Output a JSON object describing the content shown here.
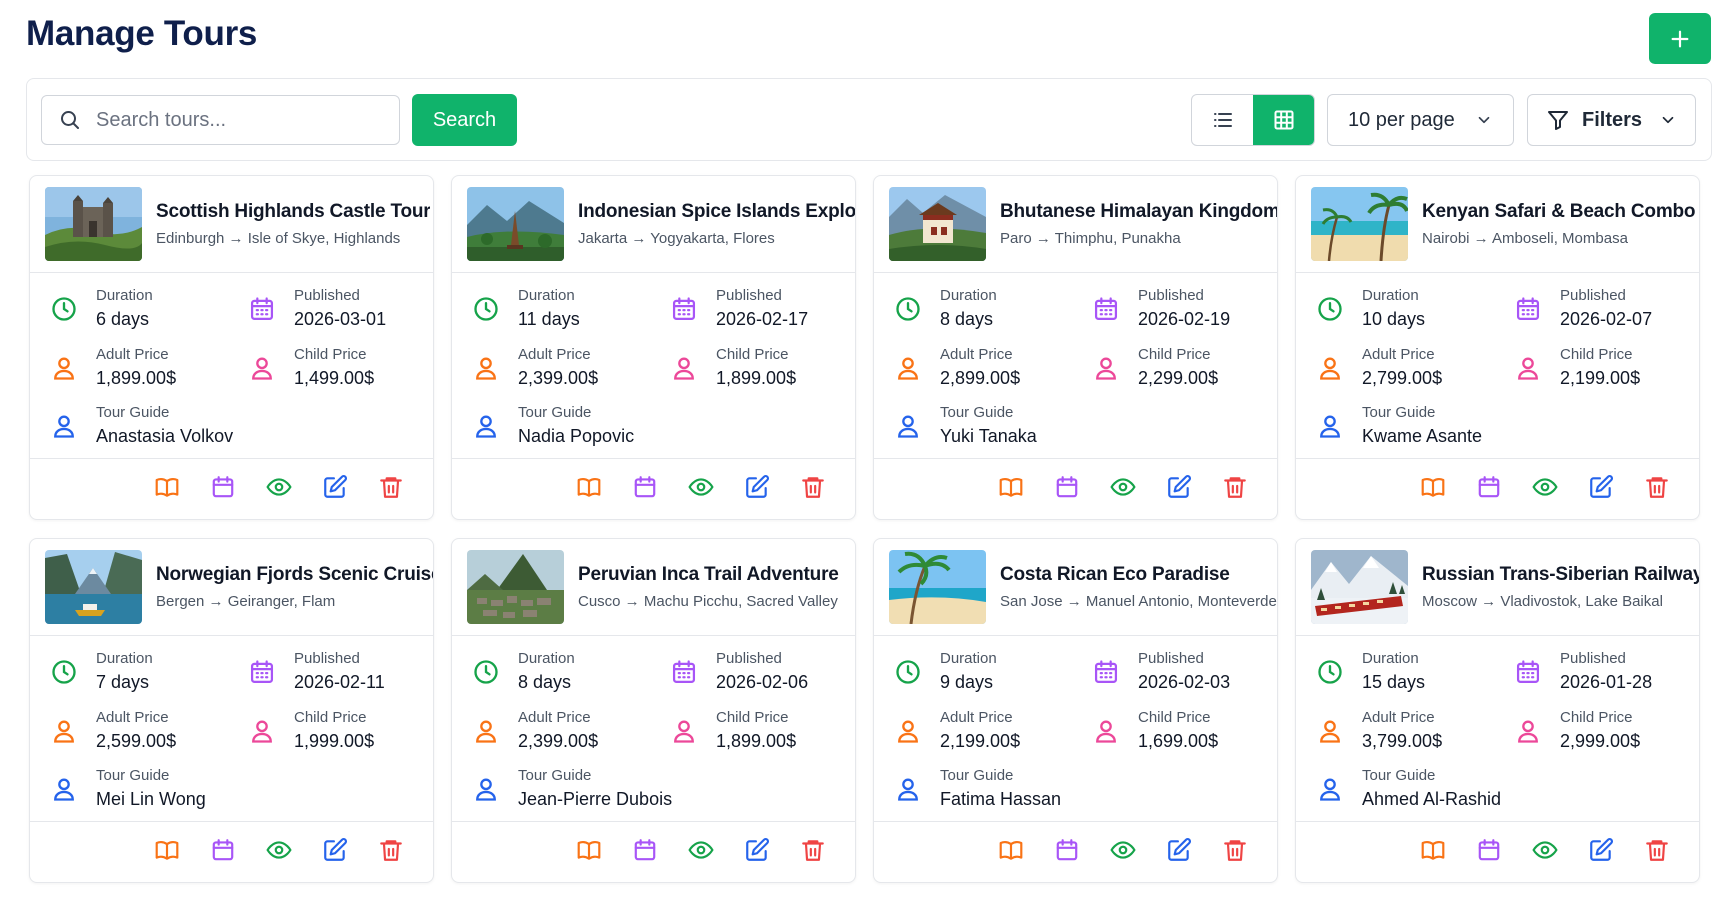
{
  "header": {
    "title": "Manage Tours",
    "add_icon": "plus-icon"
  },
  "toolbar": {
    "search_placeholder": "Search tours...",
    "search_label": "Search",
    "per_page": "10 per page",
    "filters_label": "Filters"
  },
  "labels": {
    "duration": "Duration",
    "published": "Published",
    "adult_price": "Adult Price",
    "child_price": "Child Price",
    "tour_guide": "Tour Guide"
  },
  "colors": {
    "primary": "#10b36b",
    "title": "#0f1f4b",
    "duration_icon": "#16a34a",
    "published_icon": "#a855f7",
    "adult_icon": "#f97316",
    "child_icon": "#ec4899",
    "guide_icon": "#2563eb",
    "delete_icon": "#ef4444"
  },
  "tours": [
    {
      "title": "Scottish Highlands Castle Tour",
      "route": "Edinburgh → Isle of Skye, Highlands",
      "duration": "6 days",
      "published": "2026-03-01",
      "adult_price": "1,899.00$",
      "child_price": "1,499.00$",
      "guide": "Anastasia Volkov",
      "thumb": "castle"
    },
    {
      "title": "Indonesian Spice Islands Explorer",
      "route": "Jakarta → Yogyakarta, Flores",
      "duration": "11 days",
      "published": "2026-02-17",
      "adult_price": "2,399.00$",
      "child_price": "1,899.00$",
      "guide": "Nadia Popovic",
      "thumb": "temple"
    },
    {
      "title": "Bhutanese Himalayan Kingdom",
      "route": "Paro → Thimphu, Punakha",
      "duration": "8 days",
      "published": "2026-02-19",
      "adult_price": "2,899.00$",
      "child_price": "2,299.00$",
      "guide": "Yuki Tanaka",
      "thumb": "monastery"
    },
    {
      "title": "Kenyan Safari & Beach Combo",
      "route": "Nairobi → Amboseli, Mombasa",
      "duration": "10 days",
      "published": "2026-02-07",
      "adult_price": "2,799.00$",
      "child_price": "2,199.00$",
      "guide": "Kwame Asante",
      "thumb": "beach"
    },
    {
      "title": "Norwegian Fjords Scenic Cruise",
      "route": "Bergen → Geiranger, Flam",
      "duration": "7 days",
      "published": "2026-02-11",
      "adult_price": "2,599.00$",
      "child_price": "1,999.00$",
      "guide": "Mei Lin Wong",
      "thumb": "fjord"
    },
    {
      "title": "Peruvian Inca Trail Adventure",
      "route": "Cusco → Machu Picchu, Sacred Valley",
      "duration": "8 days",
      "published": "2026-02-06",
      "adult_price": "2,399.00$",
      "child_price": "1,899.00$",
      "guide": "Jean-Pierre Dubois",
      "thumb": "ruins"
    },
    {
      "title": "Costa Rican Eco Paradise",
      "route": "San Jose → Manuel Antonio, Monteverde",
      "duration": "9 days",
      "published": "2026-02-03",
      "adult_price": "2,199.00$",
      "child_price": "1,699.00$",
      "guide": "Fatima Hassan",
      "thumb": "palm"
    },
    {
      "title": "Russian Trans-Siberian Railway",
      "route": "Moscow → Vladivostok, Lake Baikal",
      "duration": "15 days",
      "published": "2026-01-28",
      "adult_price": "3,799.00$",
      "child_price": "2,999.00$",
      "guide": "Ahmed Al-Rashid",
      "thumb": "train"
    }
  ],
  "actions": [
    {
      "name": "itinerary-button",
      "icon": "book-open-icon",
      "color": "#f97316"
    },
    {
      "name": "schedule-button",
      "icon": "calendar-icon",
      "color": "#a855f7"
    },
    {
      "name": "view-button",
      "icon": "eye-icon",
      "color": "#16a34a"
    },
    {
      "name": "edit-button",
      "icon": "edit-icon",
      "color": "#2563eb"
    },
    {
      "name": "delete-button",
      "icon": "trash-icon",
      "color": "#ef4444"
    }
  ]
}
